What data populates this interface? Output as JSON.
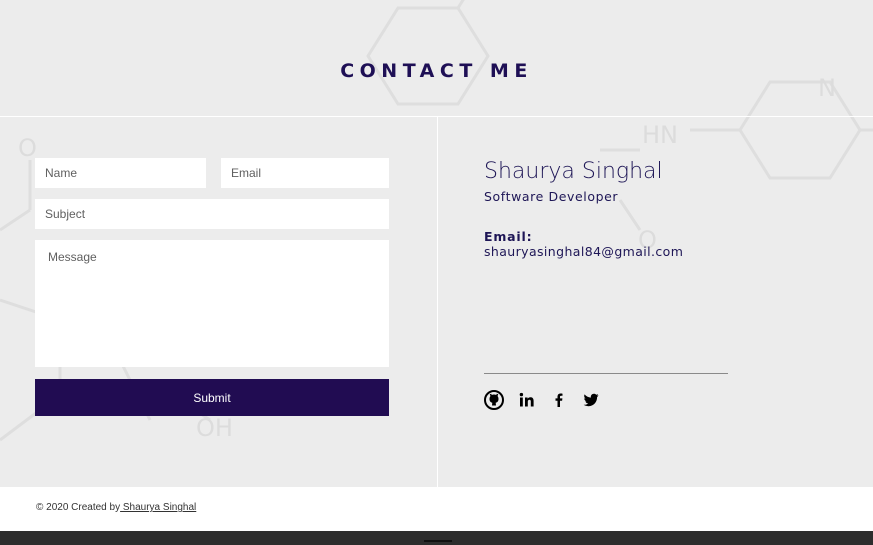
{
  "header": {
    "title": "CONTACT ME"
  },
  "form": {
    "name_placeholder": "Name",
    "email_placeholder": "Email",
    "subject_placeholder": "Subject",
    "message_placeholder": "Message",
    "submit_label": "Submit"
  },
  "profile": {
    "name": "Shaurya Singhal",
    "role": "Software Developer",
    "email_label": "Email:",
    "email": "shauryasinghal84@gmail.com"
  },
  "social": [
    {
      "icon": "github-icon"
    },
    {
      "icon": "linkedin-icon"
    },
    {
      "icon": "facebook-icon"
    },
    {
      "icon": "twitter-icon"
    }
  ],
  "background": {
    "chem_labels": [
      "O",
      "HN",
      "N",
      "O",
      "OH"
    ]
  },
  "footer": {
    "copyright_prefix": "© 2020 Created by",
    "author_link": " Shaurya Singhal"
  },
  "colors": {
    "accent": "#210c52",
    "text": "#1e1656",
    "background": "#ececec"
  }
}
